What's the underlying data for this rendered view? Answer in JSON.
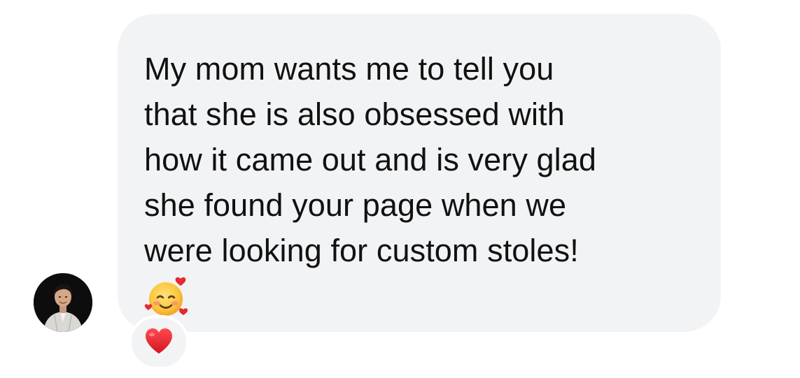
{
  "message": {
    "text": "My mom wants me to tell you\nthat she is also obsessed with\nhow it came out and is very glad\nshe found your page when we\nwere looking for custom stoles!",
    "emoji": "smiling-face-with-hearts",
    "bubble_color": "#f2f3f5",
    "text_color": "#111111"
  },
  "reaction": {
    "emoji": "red-heart",
    "color": "#e0202a"
  },
  "sender": {
    "avatar": "profile-photo"
  }
}
